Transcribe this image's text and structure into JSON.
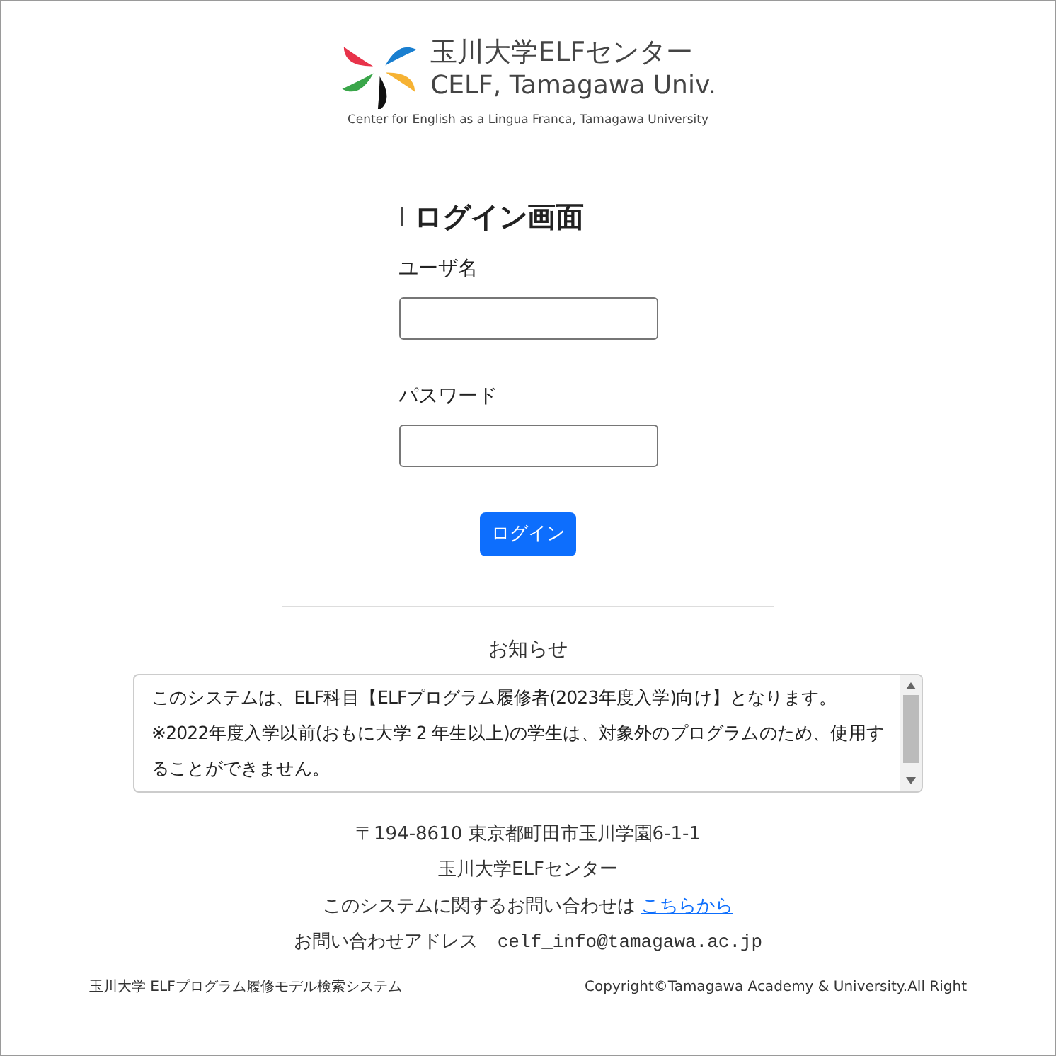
{
  "logo": {
    "title": "玉川大学ELFセンター",
    "subtitle": "CELF, Tamagawa Univ.",
    "tagline": "Center for English as a Lingua Franca, Tamagawa University"
  },
  "login": {
    "heading": "ログイン画面",
    "fields": [
      {
        "label": "ユーザ名"
      },
      {
        "label": "パスワード"
      }
    ],
    "button": "ログイン"
  },
  "notice": {
    "title": "お知らせ",
    "lines": [
      "このシステムは、ELF科目【ELFプログラム履修者(2023年度入学)向け】となります。",
      "※2022年度入学以前(おもに大学 2 年生以上)の学生は、対象外のプログラムのため、使用することができません。"
    ]
  },
  "contact": {
    "address": "〒194-8610 東京都町田市玉川学園6-1-1",
    "org": "玉川大学ELFセンター",
    "inquiry": "このシステムに関するお問い合わせは",
    "inquiry_link": "こちらから",
    "mail_label": "お問い合わせアドレス",
    "mail": "celf_info@tamagawa.ac.jp"
  },
  "footer": {
    "left": "玉川大学 ELFプログラム履修モデル検索システム",
    "right": "Copyright©Tamagawa Academy & University.All Right"
  }
}
